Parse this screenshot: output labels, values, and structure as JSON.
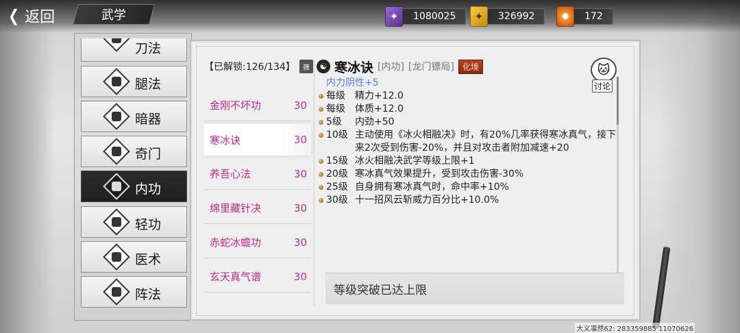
{
  "header": {
    "back_label": "返回",
    "section_title": "武学"
  },
  "currencies": [
    {
      "icon": "purple-scroll-icon",
      "value": "1080025"
    },
    {
      "icon": "gold-book-icon",
      "value": "326992"
    },
    {
      "icon": "flame-icon",
      "value": "172"
    }
  ],
  "categories": [
    {
      "label": "刀法",
      "icon": "blade-icon",
      "active": false
    },
    {
      "label": "腿法",
      "icon": "kick-icon",
      "active": false
    },
    {
      "label": "暗器",
      "icon": "shuriken-icon",
      "active": false
    },
    {
      "label": "奇门",
      "icon": "odd-weapon-icon",
      "active": false
    },
    {
      "label": "内功",
      "icon": "inner-power-icon",
      "active": true
    },
    {
      "label": "轻功",
      "icon": "lightness-icon",
      "active": false
    },
    {
      "label": "医术",
      "icon": "medicine-icon",
      "active": false
    },
    {
      "label": "阵法",
      "icon": "formation-icon",
      "active": false
    }
  ],
  "unlock": {
    "label": "【已解锁:126/134】",
    "filter_label": "筛"
  },
  "skills": [
    {
      "name": "金刚不坏功",
      "level": "30"
    },
    {
      "name": "寒冰诀",
      "level": "30",
      "selected": true
    },
    {
      "name": "养吾心法",
      "level": "30"
    },
    {
      "name": "绵里藏针决",
      "level": "30"
    },
    {
      "name": "赤蛇冰蟾功",
      "level": "30"
    },
    {
      "name": "玄天真气谱",
      "level": "30"
    }
  ],
  "detail": {
    "name": "寒冰诀",
    "type_tag": "[内功]",
    "source_tag": "[龙门镖局]",
    "realm": "化境",
    "first_line": "内力阴性+5",
    "effects": [
      {
        "lv": "每级",
        "txt": "精力+12.0"
      },
      {
        "lv": "每级",
        "txt": "体质+12.0"
      },
      {
        "lv": "5级",
        "txt": "内劲+50"
      },
      {
        "lv": "10级",
        "txt": "主动使用《冰火相融决》时，有20%几率获得寒冰真气，接下来2次受到伤害-20%，并且对攻击者附加减速+20"
      },
      {
        "lv": "15级",
        "txt": "冰火相融决武学等级上限+1"
      },
      {
        "lv": "20级",
        "txt": "寒冰真气效果提升，受到攻击伤害-30%"
      },
      {
        "lv": "25级",
        "txt": "自身拥有寒冰真气时，命中率+10%"
      },
      {
        "lv": "30级",
        "txt": "十一招风云斩威力百分比+10.0%"
      }
    ],
    "note": "等级突破已达上限",
    "discuss_label": "讨论"
  },
  "footer": {
    "id_text": "大义凛然62: 283359885  11070626"
  },
  "colors": {
    "skill_text": "#c12b8a",
    "first_effect": "#4a88d8",
    "realm_bg": "#b5461e"
  }
}
